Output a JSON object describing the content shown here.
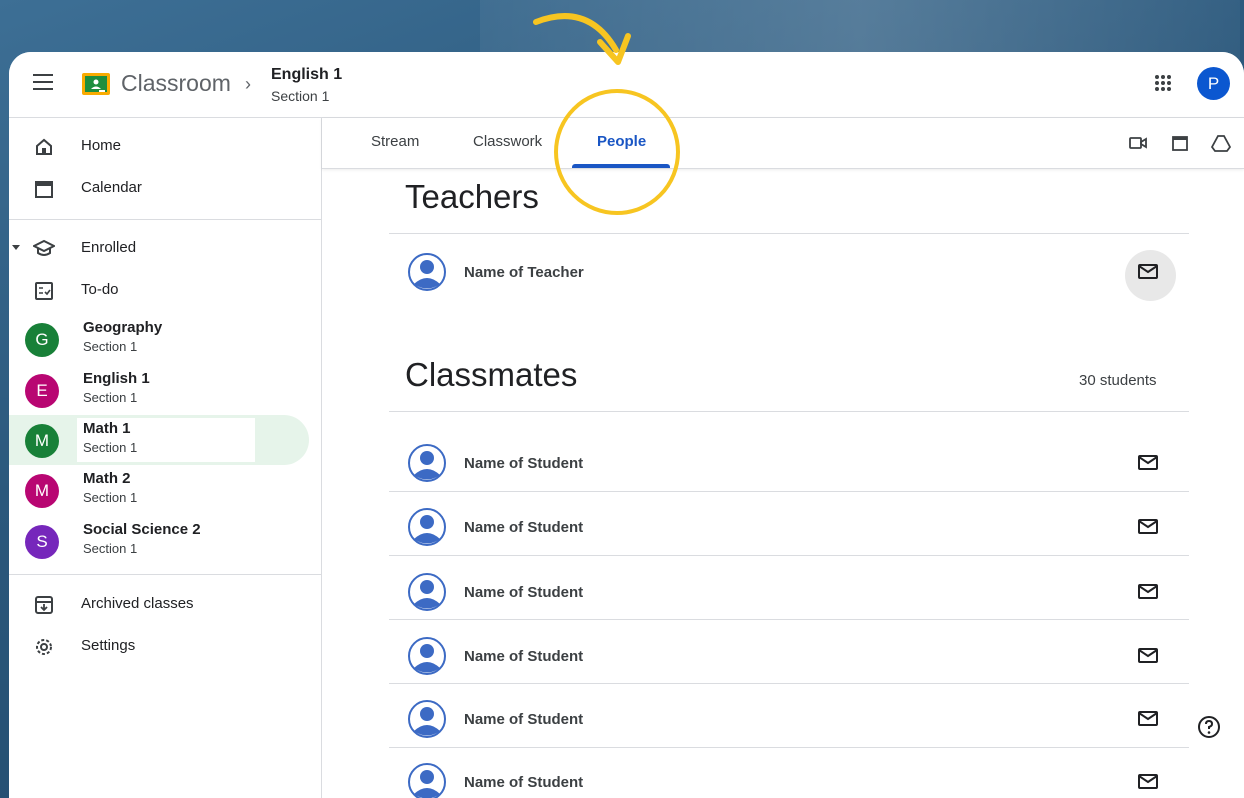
{
  "header": {
    "brand": "Classroom",
    "course_title": "English 1",
    "course_section": "Section 1",
    "avatar_letter": "P"
  },
  "sidebar": {
    "home_label": "Home",
    "calendar_label": "Calendar",
    "enrolled_label": "Enrolled",
    "todo_label": "To-do",
    "classes": [
      {
        "letter": "G",
        "name": "Geography",
        "section": "Section 1",
        "color": "#188038"
      },
      {
        "letter": "E",
        "name": "English 1",
        "section": "Section 1",
        "color": "#b80672"
      },
      {
        "letter": "M",
        "name": "Math 1",
        "section": "Section 1",
        "color": "#188038"
      },
      {
        "letter": "M",
        "name": "Math 2",
        "section": "Section 1",
        "color": "#b80672"
      },
      {
        "letter": "S",
        "name": "Social Science 2",
        "section": "Section 1",
        "color": "#7627bb"
      }
    ],
    "archived_label": "Archived classes",
    "settings_label": "Settings"
  },
  "tabs": {
    "stream": "Stream",
    "classwork": "Classwork",
    "people": "People"
  },
  "people": {
    "teachers_title": "Teachers",
    "teacher_name": "Name of Teacher",
    "classmates_title": "Classmates",
    "classmates_count": "30 students",
    "students": [
      "Name of Student",
      "Name of Student",
      "Name of Student",
      "Name of Student",
      "Name of Student",
      "Name of Student"
    ]
  },
  "colors": {
    "accent": "#1a56c4",
    "annotation": "#f7c521",
    "active_class_bg": "#e6f4ea"
  }
}
